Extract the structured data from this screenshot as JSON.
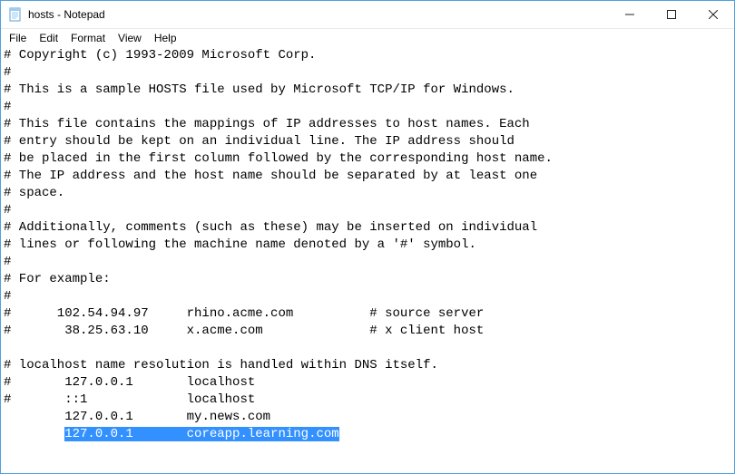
{
  "window": {
    "title": "hosts - Notepad"
  },
  "menu": {
    "items": [
      "File",
      "Edit",
      "Format",
      "View",
      "Help"
    ]
  },
  "document": {
    "lines": [
      "# Copyright (c) 1993-2009 Microsoft Corp.",
      "#",
      "# This is a sample HOSTS file used by Microsoft TCP/IP for Windows.",
      "#",
      "# This file contains the mappings of IP addresses to host names. Each",
      "# entry should be kept on an individual line. The IP address should",
      "# be placed in the first column followed by the corresponding host name.",
      "# The IP address and the host name should be separated by at least one",
      "# space.",
      "#",
      "# Additionally, comments (such as these) may be inserted on individual",
      "# lines or following the machine name denoted by a '#' symbol.",
      "#",
      "# For example:",
      "#",
      "#      102.54.94.97     rhino.acme.com          # source server",
      "#       38.25.63.10     x.acme.com              # x client host",
      "",
      "# localhost name resolution is handled within DNS itself.",
      "#\t127.0.0.1       localhost",
      "#\t::1             localhost",
      "\t127.0.0.1       my.news.com"
    ],
    "selected_line_prefix": "\t",
    "selected_line": "127.0.0.1       coreapp.learning.com"
  }
}
